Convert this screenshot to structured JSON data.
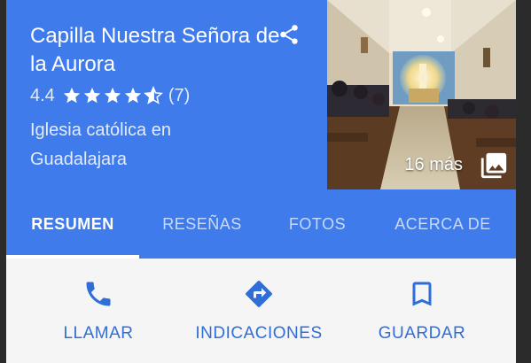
{
  "place": {
    "name": "Capilla Nuestra Señora de la Aurora",
    "rating": "4.4",
    "stars_filled_fraction": 0.88,
    "review_count": "(7)",
    "category": "Iglesia católica en Guadalajara"
  },
  "photo": {
    "count_label": "16 más"
  },
  "tabs": [
    {
      "label": "RESUMEN",
      "active": true
    },
    {
      "label": "RESEÑAS",
      "active": false
    },
    {
      "label": "FOTOS",
      "active": false
    },
    {
      "label": "ACERCA DE",
      "active": false
    }
  ],
  "actions": [
    {
      "label": "LLAMAR",
      "icon": "phone-icon"
    },
    {
      "label": "INDICACIONES",
      "icon": "directions-icon"
    },
    {
      "label": "GUARDAR",
      "icon": "bookmark-icon"
    }
  ],
  "colors": {
    "header_blue": "#3f7bea",
    "action_blue": "#2f6ed9",
    "background": "#f5f5f5"
  }
}
